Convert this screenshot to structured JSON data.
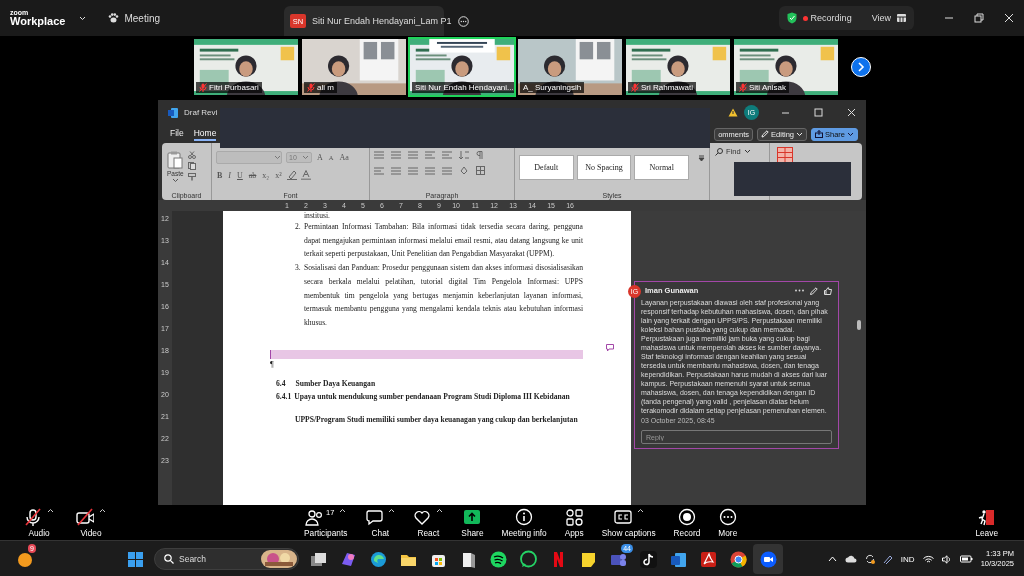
{
  "zoom_bar": {
    "logo_small": "zoom",
    "logo": "Workplace",
    "meeting": "Meeting",
    "tab": {
      "avatar": "SN",
      "title": "Siti Nur Endah Hendayani_Lam P1"
    },
    "recording": "Recording",
    "view": "View"
  },
  "video_tiles": [
    {
      "name": "Fitri Purbasari",
      "muted": true,
      "selected": false
    },
    {
      "name": "ali m",
      "muted": true,
      "selected": false
    },
    {
      "name": "Siti Nur Endah Hendayani...",
      "muted": false,
      "selected": true
    },
    {
      "name": "A_ Suryaningsih",
      "muted": false,
      "selected": false
    },
    {
      "name": "Sri Rahmawati",
      "muted": true,
      "selected": false
    },
    {
      "name": "Siti Anisak",
      "muted": true,
      "selected": false
    }
  ],
  "word": {
    "title": "Draf Revi",
    "avatar": "IG",
    "menu": [
      {
        "label": "File",
        "selected": false
      },
      {
        "label": "Home",
        "selected": true
      }
    ],
    "comments_button": "omments",
    "editing_button": "Editing",
    "share_button": "Share",
    "ribbon": {
      "paste": "Paste",
      "font_size": "10",
      "grow": "A",
      "shrink": "A",
      "case": "Aa",
      "font_buttons": [
        "B",
        "I",
        "U",
        "ab",
        "x₂",
        "x²"
      ],
      "styles": [
        {
          "label": "Default"
        },
        {
          "label": "No Spacing"
        },
        {
          "label": "Normal"
        }
      ],
      "find": "Find",
      "groups": [
        "Clipboard",
        "Font",
        "Paragraph",
        "Styles"
      ]
    },
    "ruler": [
      "1",
      "2",
      "3",
      "4",
      "5",
      "6",
      "7",
      "8",
      "9",
      "10",
      "11",
      "12",
      "13",
      "14",
      "15",
      "16"
    ],
    "vertical_ruler": [
      "12",
      "13",
      "14",
      "15",
      "16",
      "17",
      "18",
      "19",
      "20",
      "21",
      "22",
      "23"
    ],
    "document": {
      "cut_line": "institusi.",
      "list": [
        {
          "number": "2.",
          "text": "Permintaan Informasi Tambahan: Bila informasi tidak tersedia secara daring, pengguna dapat mengajukan permintaan informasi melalui email resmi, atau datang langsung ke unit terkait seperti perpustakaan, Unit Penelitian dan Pengabdian Masyarakat (UPPM)."
        },
        {
          "number": "3.",
          "text": "Sosialisasi dan Panduan: Prosedur penggunaan sistem dan akses informasi disosialisasikan secara berkala melalui pelatihan, tutorial digital Tim Pengelola Informasi: UPPS membentuk tim pengelola yang bertugas menjamin keberlanjutan layanan informasi, termasuk membantu pengguna yang mengalami kendala teknis atau kebutuhan informasi khusus."
        }
      ],
      "mark": "¶",
      "heading": {
        "number": "6.4",
        "text": "Sumber Daya Keuangan"
      },
      "subheading": {
        "number": "6.4.1",
        "text": "Upaya untuk mendukung sumber pendanaan Program Studi Diploma III Kebidanan"
      },
      "paragraph": "UPPS/Program Studi memiliki sumber daya keuanagan yang cukup dan berkelanjutan"
    },
    "comment": {
      "avatar": "IG",
      "author": "Iman Gunawan",
      "text": "Layanan perpustakaan diawasi oleh staf profesional yang responsif terhadap kebutuhan mahasiswa, dosen, dan pihak lain yang terkait dengan UPPS/PS. Perpustakaan memiliki koleksi bahan pustaka yang cukup dan memadai. Perpustakaan juga memiliki jam buka yang cukup bagi mahasiswa untuk memperolah akses ke sumber dayanya. Staf teknologi informasi dengan keahlian yang sesuai tersedia untuk membantu mahasiswa, dosen, dan tenaga kependidikan. Perpustakaan harus mudah di akses dari luar kampus. Perpustakaan memenuhi syarat untuk semua mahasiswa, dosen, dan tenaga kependidikan dengan ID (tanda pengenal) yang valid , penjelasan diatas belum terakomodir didalam setiap penjelasan pemenuhan elemen.",
      "date": "03 October 2025, 08:45",
      "reply_placeholder": "Reply"
    }
  },
  "toolbar": [
    {
      "label": "Audio",
      "muted": true,
      "caret": true
    },
    {
      "label": "Video",
      "muted": true,
      "caret": true
    },
    {
      "label": "Participants",
      "count": "17",
      "caret": true
    },
    {
      "label": "Chat",
      "caret": true
    },
    {
      "label": "React",
      "caret": true
    },
    {
      "label": "Share",
      "caret": false
    },
    {
      "label": "Meeting info",
      "caret": false
    },
    {
      "label": "Apps",
      "caret": false
    },
    {
      "label": "Show captions",
      "caret": true
    },
    {
      "label": "Record",
      "caret": false
    },
    {
      "label": "More",
      "caret": false
    },
    {
      "label": "Leave",
      "caret": false
    }
  ],
  "taskbar": {
    "weather_badge": "9",
    "search_placeholder": "Search",
    "apps_badge": "44",
    "language": "IND",
    "time": "1:33 PM",
    "date": "10/3/2025"
  }
}
